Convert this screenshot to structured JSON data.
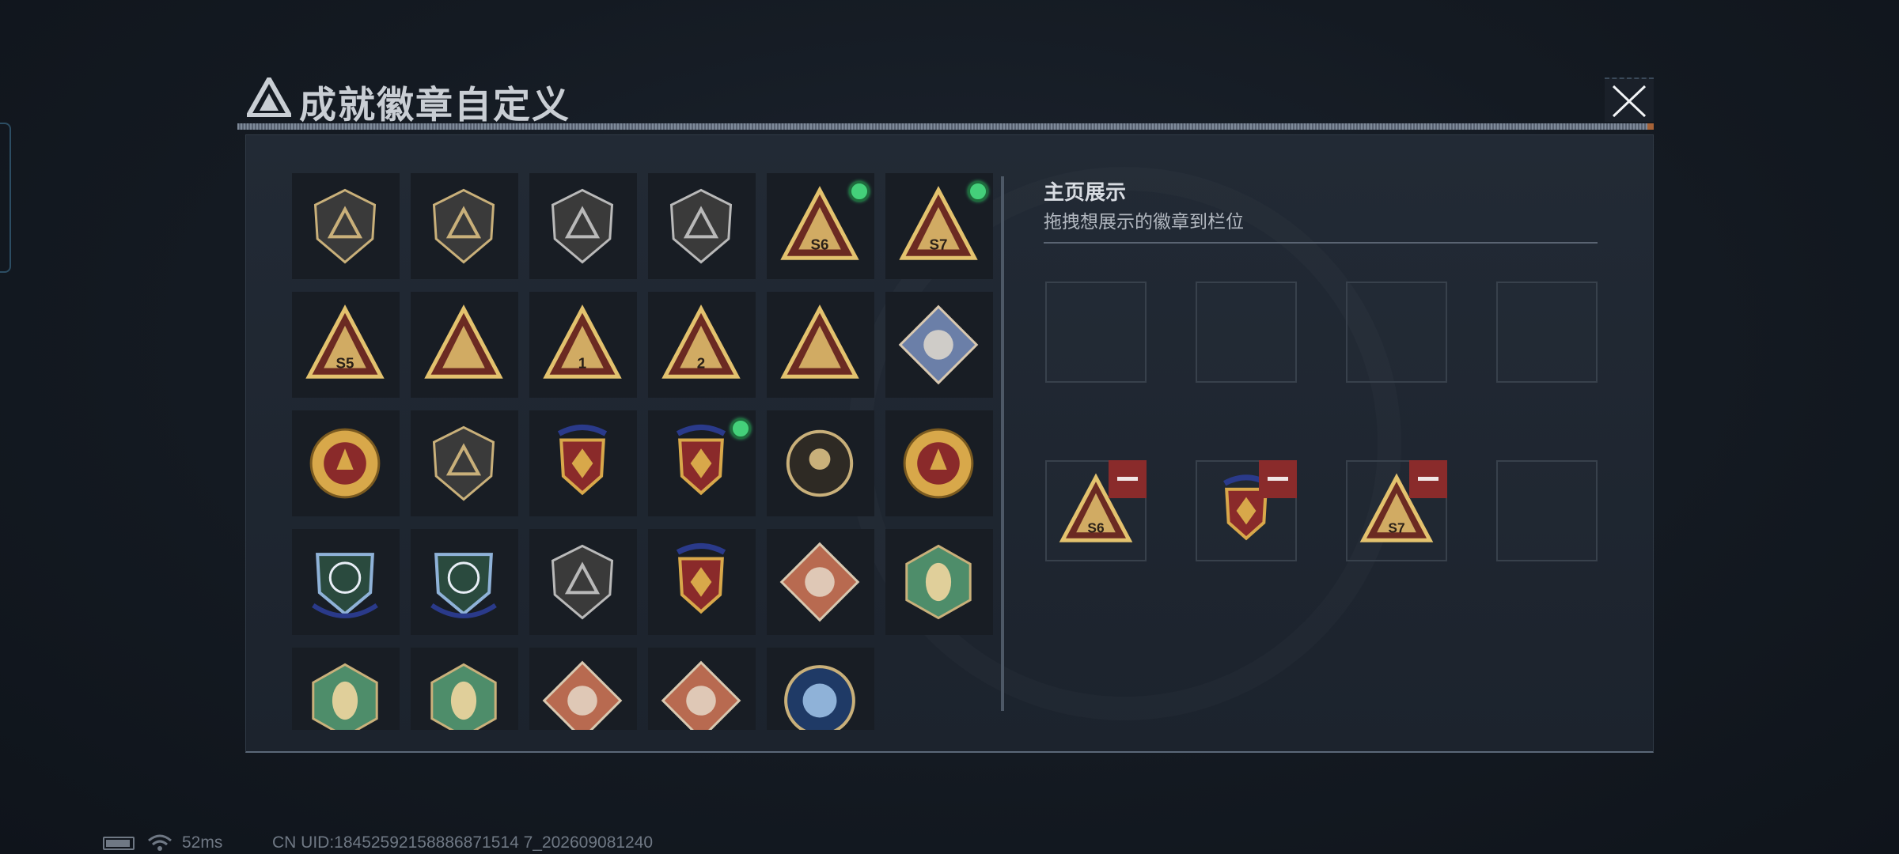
{
  "window": {
    "title": "成就徽章自定义",
    "close_label": "×"
  },
  "badges": [
    {
      "name": "triangle-logo-shield-badge",
      "kind": "shield",
      "color": "#c9b07a",
      "new": false
    },
    {
      "name": "helicopter-shield-badge",
      "kind": "shield",
      "color": "#c9b07a",
      "new": false
    },
    {
      "name": "diamond-emblem-shield-badge",
      "kind": "shield",
      "color": "#b9b9b9",
      "new": false
    },
    {
      "name": "dagger-shield-badge",
      "kind": "shield",
      "color": "#b9b9b9",
      "new": false
    },
    {
      "name": "s6-triangle-badge",
      "kind": "triangle",
      "text": "S6",
      "color": "#e3c26e",
      "new": true
    },
    {
      "name": "s7-triangle-badge",
      "kind": "triangle",
      "text": "S7",
      "color": "#e3c26e",
      "new": true
    },
    {
      "name": "s5-triangle-badge",
      "kind": "triangle",
      "text": "S5",
      "color": "#e3c26e",
      "new": false
    },
    {
      "name": "boat-triangle-badge",
      "kind": "triangle",
      "text": "",
      "color": "#e3c26e",
      "new": false
    },
    {
      "name": "rank-1-triangle-badge",
      "kind": "triangle",
      "text": "1",
      "color": "#e3c26e",
      "new": false
    },
    {
      "name": "rank-2-triangle-badge",
      "kind": "triangle",
      "text": "2",
      "color": "#e3c26e",
      "new": false
    },
    {
      "name": "soldiers-triangle-badge",
      "kind": "triangle",
      "text": "",
      "color": "#e3c26e",
      "new": false
    },
    {
      "name": "rose-diamond-badge",
      "kind": "diamond",
      "color": "#6b7fa8",
      "new": false
    },
    {
      "name": "star-medal-badge",
      "kind": "medal",
      "color": "#d8a84a",
      "new": false
    },
    {
      "name": "crest-shield-badge",
      "kind": "shield",
      "color": "#c9b07a",
      "new": false
    },
    {
      "name": "laurel-crest-badge",
      "kind": "crest",
      "color": "#d8a84a",
      "new": false
    },
    {
      "name": "gem-crest-badge",
      "kind": "crest",
      "color": "#d8a84a",
      "new": true
    },
    {
      "name": "skull-round-badge",
      "kind": "round",
      "color": "#c9b07a",
      "new": false
    },
    {
      "name": "tiger-medal-badge",
      "kind": "medal",
      "color": "#d8a84a",
      "new": false
    },
    {
      "name": "rifle-blue-crest-badge",
      "kind": "bluecrest",
      "color": "#8fb2d8",
      "new": false
    },
    {
      "name": "sniper-blue-crest-badge",
      "kind": "bluecrest",
      "color": "#8fb2d8",
      "new": false
    },
    {
      "name": "knife-shield-badge",
      "kind": "shield",
      "color": "#b9b9b9",
      "new": false
    },
    {
      "name": "gold-sword-crest-badge",
      "kind": "crest",
      "color": "#d8a84a",
      "new": false
    },
    {
      "name": "wolf-diamond-badge",
      "kind": "diamond",
      "color": "#b86a50",
      "new": false
    },
    {
      "name": "wasp-hexagon-badge",
      "kind": "hexagon",
      "color": "#4e8d6a",
      "new": false
    },
    {
      "name": "bee-hexagon-badge",
      "kind": "hexagon",
      "color": "#4e8d6a",
      "new": false
    },
    {
      "name": "tools-hexagon-badge",
      "kind": "hexagon",
      "color": "#4e8d6a",
      "new": false
    },
    {
      "name": "dragon-diamond-badge",
      "kind": "diamond",
      "color": "#b86a50",
      "new": false
    },
    {
      "name": "runner-diamond-badge",
      "kind": "diamond",
      "color": "#b86a50",
      "new": false
    },
    {
      "name": "lynx-round-badge",
      "kind": "blueround",
      "color": "#8fb2d8",
      "new": false
    }
  ],
  "showcase": {
    "title": "主页展示",
    "subtitle": "拖拽想展示的徽章到栏位",
    "slots": [
      {
        "badge": null
      },
      {
        "badge": null
      },
      {
        "badge": null
      },
      {
        "badge": null
      },
      {
        "badge": {
          "kind": "triangle",
          "text": "S6",
          "color": "#e3c26e"
        }
      },
      {
        "badge": {
          "kind": "crest",
          "text": "",
          "color": "#d8a84a"
        }
      },
      {
        "badge": {
          "kind": "triangle",
          "text": "S7",
          "color": "#e3c26e"
        }
      },
      {
        "badge": null
      }
    ]
  },
  "status": {
    "ping": "52ms",
    "uid": "CN UID:18452592158886871514 7_202609081240"
  }
}
